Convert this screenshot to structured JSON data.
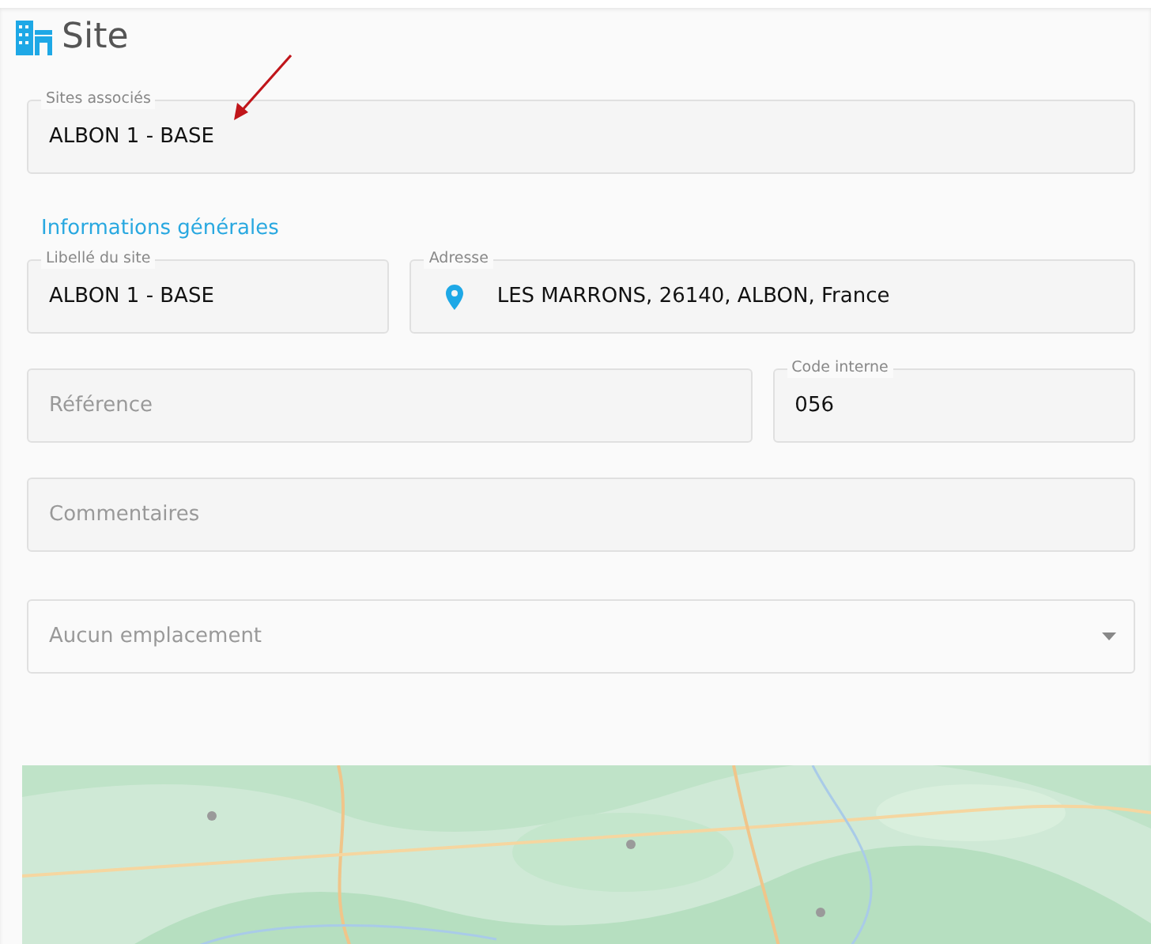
{
  "header": {
    "title": "Site"
  },
  "associated_sites": {
    "label": "Sites associés",
    "value": "ALBON 1 - BASE"
  },
  "section": {
    "title": "Informations générales"
  },
  "rows": [
    [
      {
        "kind": "text",
        "label": "Libellé du site",
        "value": "ALBON 1 - BASE"
      },
      {
        "kind": "address",
        "label": "Adresse",
        "value": "LES MARRONS, 26140, ALBON, France"
      }
    ],
    [
      {
        "kind": "empty",
        "placeholder": "Référence"
      },
      {
        "kind": "text",
        "label": "Code interne",
        "value": "056"
      }
    ],
    [
      {
        "kind": "empty",
        "placeholder": "Commentaires"
      }
    ],
    [
      {
        "kind": "select",
        "placeholder": "Aucun emplacement"
      }
    ]
  ],
  "map": {
    "kind": "picture"
  }
}
